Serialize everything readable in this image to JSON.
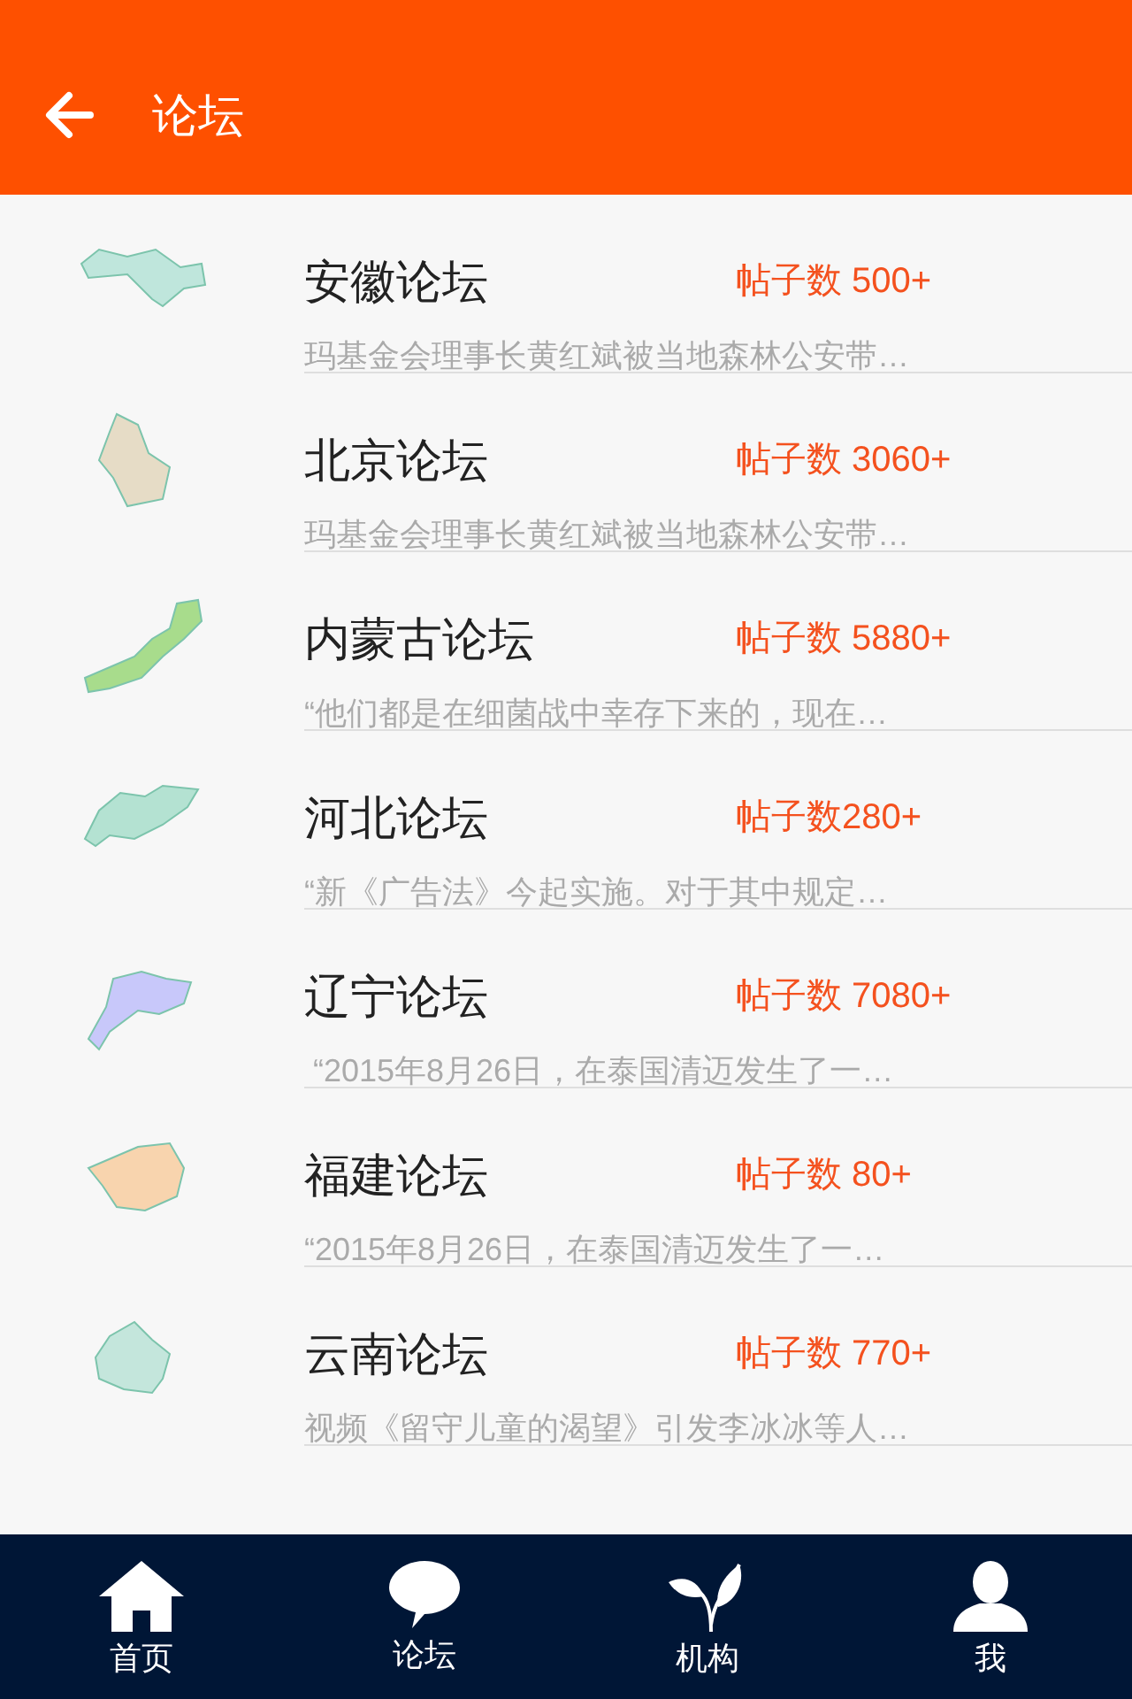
{
  "header": {
    "title": "论坛"
  },
  "forums": [
    {
      "title": "安徽论坛",
      "count": "帖子数 500+",
      "snippet": "玛基金会理事长黄红斌被当地森林公安带…",
      "color": "#bfe6dc"
    },
    {
      "title": "北京论坛",
      "count": "帖子数 3060+",
      "snippet": "玛基金会理事长黄红斌被当地森林公安带…",
      "color": "#e6dcc6"
    },
    {
      "title": "内蒙古论坛",
      "count": "帖子数 5880+",
      "snippet": "“他们都是在细菌战中幸存下来的，现在…",
      "color": "#a8dc8c"
    },
    {
      "title": "河北论坛",
      "count": "帖子数280+",
      "snippet": "“新《广告法》今起实施。对于其中规定…",
      "color": "#b4e2d2"
    },
    {
      "title": "辽宁论坛",
      "count": "帖子数 7080+",
      "snippet": " “2015年8月26日，在泰国清迈发生了一…",
      "color": "#c8c8fa"
    },
    {
      "title": "福建论坛",
      "count": "帖子数 80+",
      "snippet": "“2015年8月26日，在泰国清迈发生了一…",
      "color": "#f8d4ae"
    },
    {
      "title": "云南论坛",
      "count": "帖子数 770+",
      "snippet": "视频《留守儿童的渴望》引发李冰冰等人…",
      "color": "#c4e6dc"
    }
  ],
  "tabs": [
    {
      "label": "首页",
      "kind": "home"
    },
    {
      "label": "论坛",
      "kind": "chat"
    },
    {
      "label": "机构",
      "kind": "sprout"
    },
    {
      "label": "我",
      "kind": "person"
    }
  ]
}
